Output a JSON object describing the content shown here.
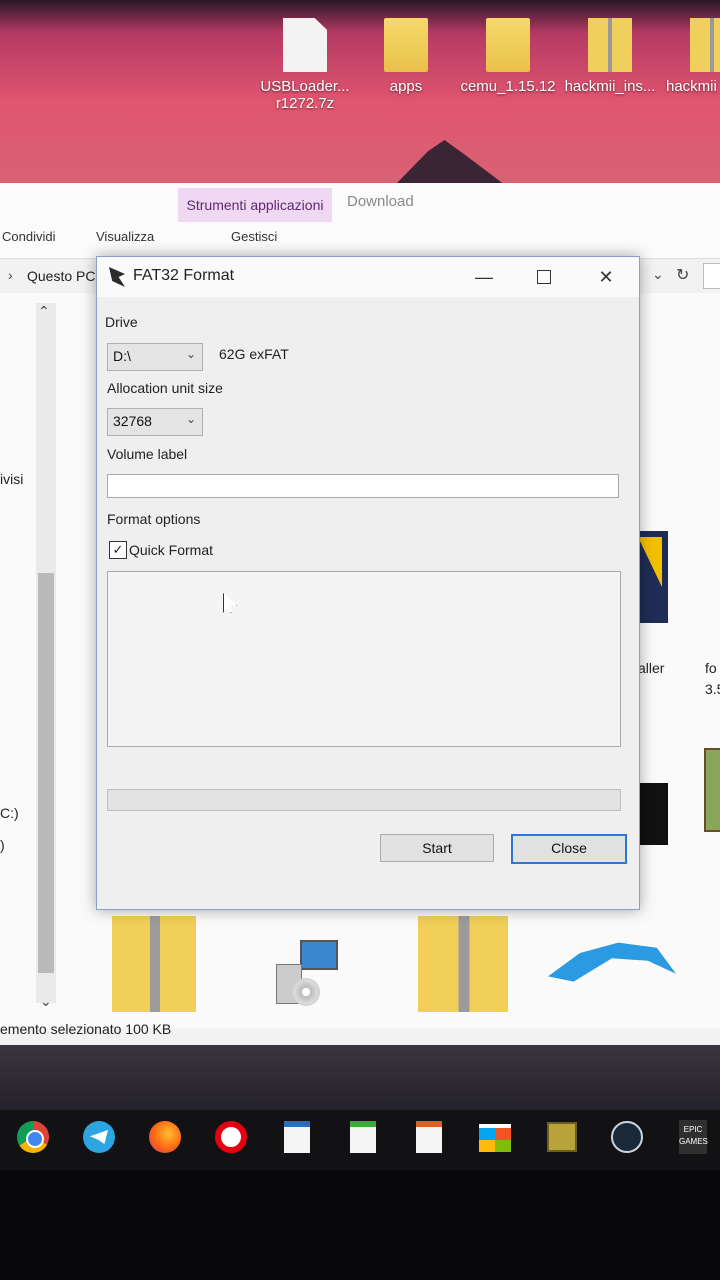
{
  "desktop": {
    "icons": [
      {
        "label": "USBLoader...",
        "sublabel": "r1272.7z",
        "icon": "file-icon"
      },
      {
        "label": "apps",
        "sublabel": "",
        "icon": "folder-icon"
      },
      {
        "label": "cemu_1.15.12",
        "sublabel": "",
        "icon": "folder-icon"
      },
      {
        "label": "hackmii_ins...",
        "sublabel": "",
        "icon": "zip-folder-icon"
      },
      {
        "label": "hackmii",
        "sublabel": "",
        "icon": "zip-folder-icon"
      }
    ]
  },
  "explorer": {
    "context_tab": "Strumenti applicazioni",
    "download_tab": "Download",
    "ribbon_cmds": [
      "Condividi",
      "Visualizza",
      "Gestisci"
    ],
    "address": "Questo PC",
    "side_texts": [
      "ivisi",
      "C:)",
      ")"
    ],
    "right_texts": [
      "aller",
      "fo",
      "3.5"
    ],
    "status": "emento selezionato  100 KB"
  },
  "taskbar": {
    "icons": [
      "chrome-icon",
      "telegram-icon",
      "firefox-icon",
      "opera-icon",
      "writer-icon",
      "calc-icon",
      "impress-icon",
      "store-icon",
      "minecraft-icon",
      "steam-icon",
      "epic-games-icon"
    ],
    "epic_label": "EPIC GAMES"
  },
  "dialog": {
    "title": "FAT32 Format",
    "drive_label": "Drive",
    "drive_value": "D:\\",
    "drive_info": "62G exFAT",
    "alloc_label": "Allocation unit size",
    "alloc_value": "32768",
    "volume_label": "Volume label",
    "volume_value": "",
    "format_options_label": "Format options",
    "quick_format_label": "Quick Format",
    "quick_format_checked": true,
    "progress": 0,
    "start_label": "Start",
    "close_label": "Close"
  },
  "colors": {
    "accent_blue": "#2b78d0",
    "context_tab_bg": "#f0d7f3"
  }
}
